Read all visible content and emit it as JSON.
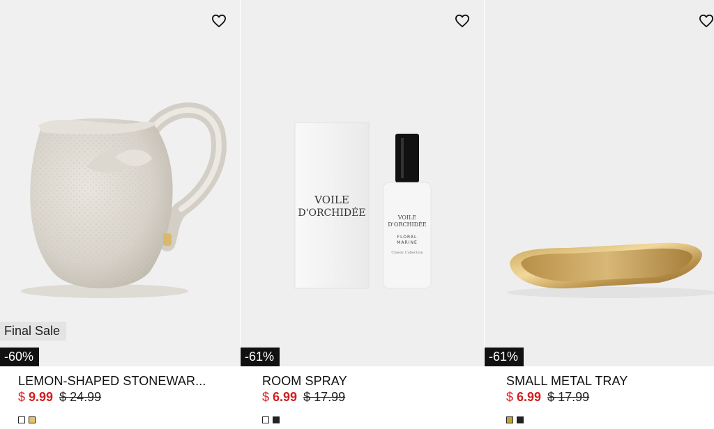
{
  "products": [
    {
      "badge_final_sale": "Final Sale",
      "discount": "-60%",
      "title": "LEMON-SHAPED STONEWAR...",
      "currency": "$",
      "price_now": "9.99",
      "price_was": "$ 24.99",
      "swatches": [
        "#ffffff",
        "#e7c165"
      ],
      "image": "white-textured-stoneware-pitcher"
    },
    {
      "discount": "-61%",
      "title": "ROOM SPRAY",
      "currency": "$",
      "price_now": "6.99",
      "price_was": "$ 17.99",
      "swatches": [
        "#ffffff",
        "#222222"
      ],
      "image": "room-spray-bottle-and-box",
      "label_brand_line1": "VOILE",
      "label_brand_line2": "D'ORCHIDÉE",
      "label_scent_line1": "FLORAL",
      "label_scent_line2": "MARINE",
      "label_collection": "Classic Collection"
    },
    {
      "discount": "-61%",
      "title": "SMALL METAL TRAY",
      "currency": "$",
      "price_now": "6.99",
      "price_was": "$ 17.99",
      "swatches": [
        "#bfa43a",
        "#222222"
      ],
      "image": "gold-oval-metal-tray"
    }
  ],
  "icons": {
    "favorite": "heart-outline-icon"
  }
}
